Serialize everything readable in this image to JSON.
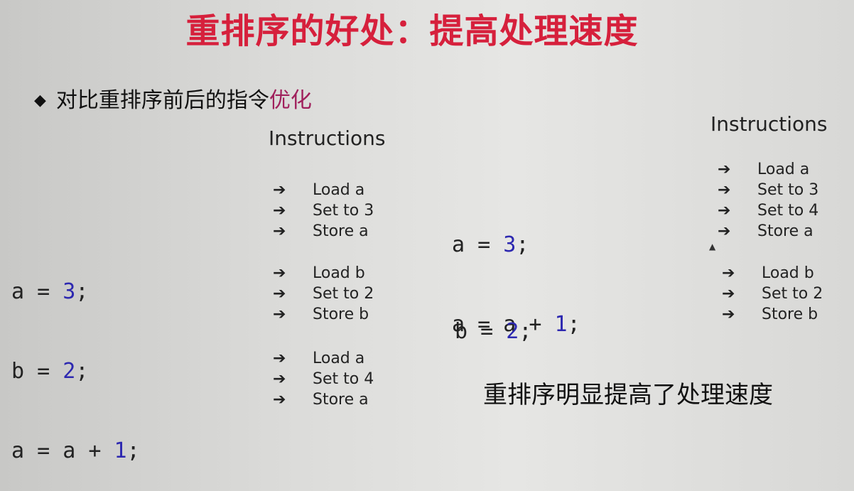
{
  "slide": {
    "title": "重排序的好处：提高处理速度",
    "bullet_mark": "◆",
    "bullet_text": "对比重排序前后的指令",
    "bullet_highlight": "优化",
    "conclusion": "重排序明显提高了处理速度"
  },
  "before": {
    "code": [
      {
        "var": "a",
        "op": " = ",
        "expr": "",
        "num": "3",
        "end": ";"
      },
      {
        "var": "b",
        "op": " = ",
        "expr": "",
        "num": "2",
        "end": ";"
      },
      {
        "var": "a",
        "op": " = ",
        "expr": "a + ",
        "num": "1",
        "end": ";"
      }
    ],
    "instructions_title": "Instructions",
    "groups": [
      [
        "Load a",
        "Set to 3",
        "Store a"
      ],
      [
        "Load b",
        "Set to 2",
        "Store b"
      ],
      [
        "Load a",
        "Set to 4",
        "Store a"
      ]
    ]
  },
  "after": {
    "code_group1": [
      {
        "var": "a",
        "op": " = ",
        "expr": "",
        "num": "3",
        "end": ";"
      },
      {
        "var": "a",
        "op": " = ",
        "expr": "a + ",
        "num": "1",
        "end": ";"
      }
    ],
    "code_group2": [
      {
        "var": "b",
        "op": " = ",
        "expr": "",
        "num": "2",
        "end": ";"
      }
    ],
    "instructions_title": "Instructions",
    "groups": [
      [
        "Load a",
        "Set to 3",
        "Set to 4",
        "Store a"
      ],
      [
        "Load b",
        "Set to 2",
        "Store b"
      ]
    ]
  },
  "arrow": "➔"
}
